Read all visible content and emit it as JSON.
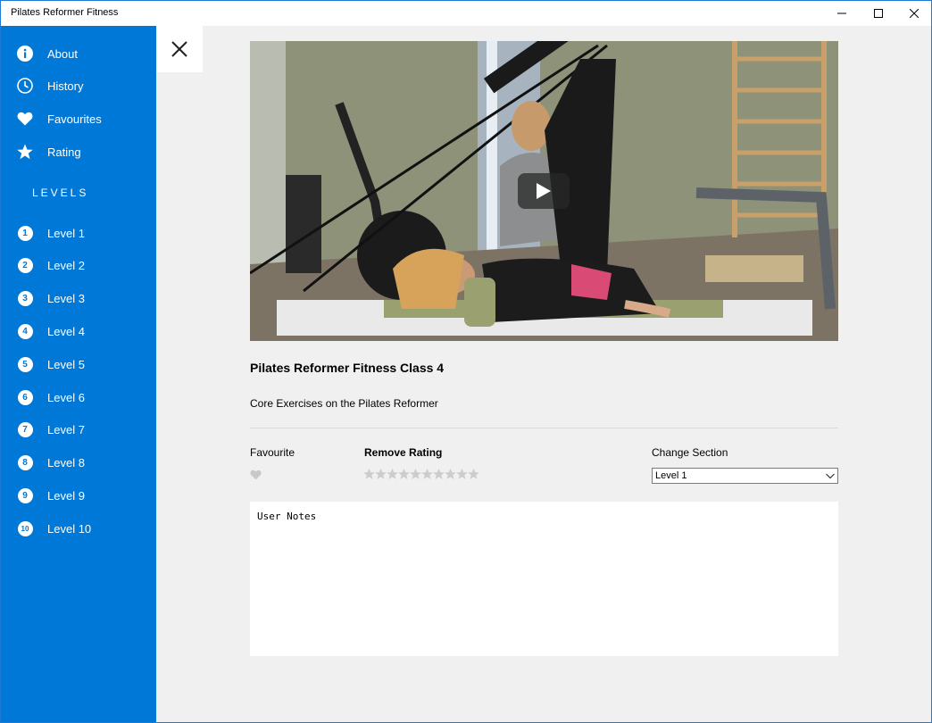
{
  "window": {
    "title": "Pilates Reformer Fitness"
  },
  "sidebar": {
    "menu": [
      {
        "label": "About",
        "icon": "info-icon"
      },
      {
        "label": "History",
        "icon": "clock-icon"
      },
      {
        "label": "Favourites",
        "icon": "heart-icon"
      },
      {
        "label": "Rating",
        "icon": "star-icon"
      }
    ],
    "levels_heading": "LEVELS",
    "levels": [
      {
        "number": "1",
        "label": "Level 1"
      },
      {
        "number": "2",
        "label": "Level 2"
      },
      {
        "number": "3",
        "label": "Level 3"
      },
      {
        "number": "4",
        "label": "Level 4"
      },
      {
        "number": "5",
        "label": "Level 5"
      },
      {
        "number": "6",
        "label": "Level 6"
      },
      {
        "number": "7",
        "label": "Level 7"
      },
      {
        "number": "8",
        "label": "Level 8"
      },
      {
        "number": "9",
        "label": "Level 9"
      },
      {
        "number": "10",
        "label": "Level 10"
      }
    ]
  },
  "detail": {
    "title": "Pilates Reformer Fitness Class 4",
    "description": "Core Exercises on the Pilates Reformer",
    "favourite_label": "Favourite",
    "rating_label": "Remove Rating",
    "rating_value": 0,
    "rating_max": 10,
    "section_label": "Change Section",
    "section_selected": "Level 1",
    "notes_placeholder": "User Notes"
  },
  "colors": {
    "accent": "#0078d7",
    "inactive_star": "#cccccc",
    "inactive_heart": "#cccccc"
  }
}
